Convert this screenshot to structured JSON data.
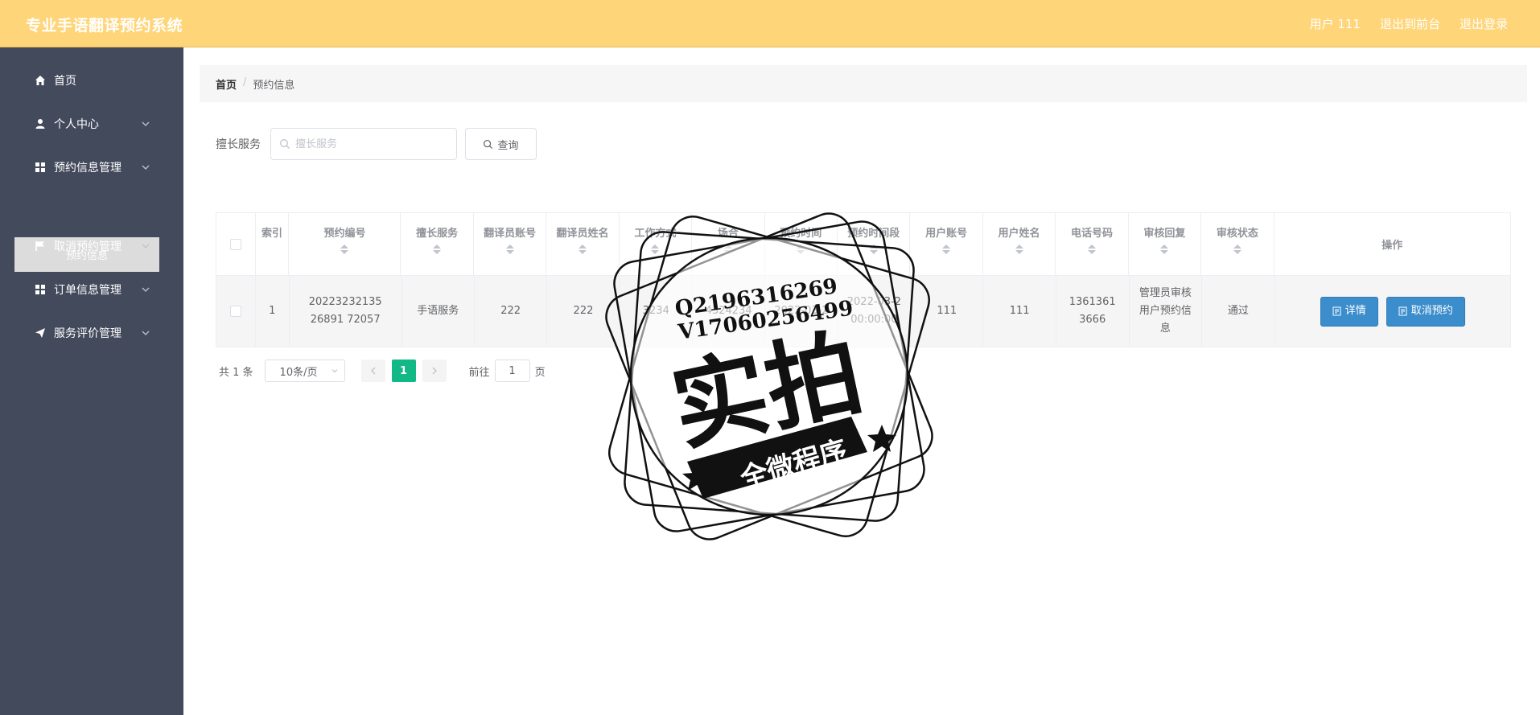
{
  "app": {
    "title": "专业手语翻译预约系统"
  },
  "topnav": {
    "user": "用户 111",
    "back_front": "退出到前台",
    "logout": "退出登录"
  },
  "sidebar": {
    "items": [
      {
        "label": "首页",
        "icon": "home-icon"
      },
      {
        "label": "个人中心",
        "icon": "user-icon"
      },
      {
        "label": "预约信息管理",
        "icon": "grid-icon"
      },
      {
        "label": "取消预约管理",
        "icon": "flag-icon"
      },
      {
        "label": "订单信息管理",
        "icon": "grid-icon"
      },
      {
        "label": "服务评价管理",
        "icon": "send-icon"
      }
    ],
    "active_sub": "预约信息"
  },
  "breadcrumb": {
    "home": "首页",
    "sep": "/",
    "current": "预约信息"
  },
  "search": {
    "label": "擅长服务",
    "placeholder": "擅长服务",
    "button": "查询"
  },
  "table": {
    "headers": [
      "索引",
      "预约编号",
      "擅长服务",
      "翻译员账号",
      "翻译员姓名",
      "工作方式",
      "场合",
      "预约时间",
      "预约时间段",
      "用户账号",
      "用户姓名",
      "电话号码",
      "审核回复",
      "审核状态",
      "操作"
    ],
    "rows": [
      {
        "index": "1",
        "order_no": "2022323213526891 72057",
        "service": "手语服务",
        "translator_account": "222",
        "translator_name": "222",
        "work_mode": "3234",
        "occasion": "4324234",
        "date": "2022-03-2",
        "time_slot": "2022-03-2 00:00:00",
        "user_account": "111",
        "user_name": "111",
        "phone": "13613613666",
        "reply": "管理员审核用户预约信息",
        "status": "通过"
      }
    ],
    "actions": {
      "detail": "详情",
      "cancel": "取消预约"
    }
  },
  "pagination": {
    "total": "共 1 条",
    "size": "10条/页",
    "current": "1",
    "goto_prefix": "前往",
    "goto_value": "1",
    "goto_suffix": "页"
  },
  "watermark": {
    "contact1": "Q2196316269",
    "contact2": "V17060256499",
    "main": "实拍",
    "banner": "全微程序"
  },
  "colors": {
    "topbar": "#ffd579",
    "sidebar": "#434a5c",
    "primary_button": "#3c8dcc",
    "page_active": "#12b886"
  }
}
